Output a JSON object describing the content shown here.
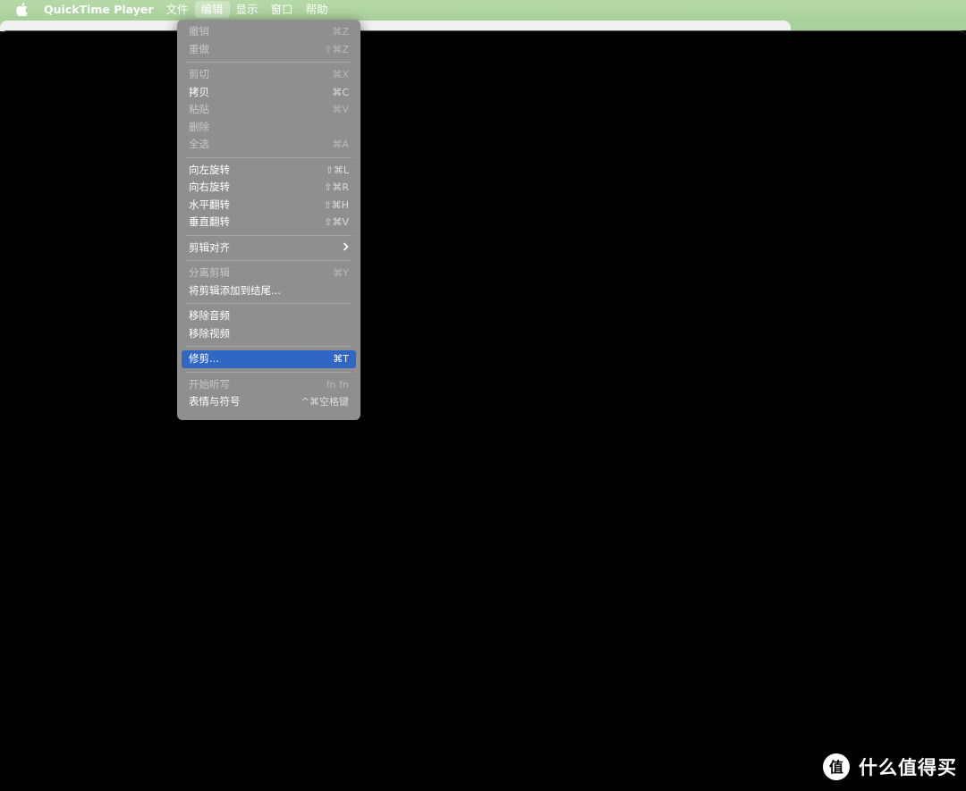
{
  "menubar": {
    "apple_icon": "apple-logo-icon",
    "app_name": "QuickTime Player",
    "items": [
      "文件",
      "编辑",
      "显示",
      "窗口",
      "帮助"
    ],
    "active_index": 1,
    "bar_color": "#a9d19c"
  },
  "edit_menu": {
    "groups": [
      [
        {
          "label": "撤销",
          "shortcut": "⌘Z",
          "enabled": false
        },
        {
          "label": "重做",
          "shortcut": "⇧⌘Z",
          "enabled": false
        }
      ],
      [
        {
          "label": "剪切",
          "shortcut": "⌘X",
          "enabled": false
        },
        {
          "label": "拷贝",
          "shortcut": "⌘C",
          "enabled": true
        },
        {
          "label": "粘贴",
          "shortcut": "⌘V",
          "enabled": false
        },
        {
          "label": "删除",
          "shortcut": "",
          "enabled": false
        },
        {
          "label": "全选",
          "shortcut": "⌘A",
          "enabled": false
        }
      ],
      [
        {
          "label": "向左旋转",
          "shortcut": "⇧⌘L",
          "enabled": true
        },
        {
          "label": "向右旋转",
          "shortcut": "⇧⌘R",
          "enabled": true
        },
        {
          "label": "水平翻转",
          "shortcut": "⇧⌘H",
          "enabled": true
        },
        {
          "label": "垂直翻转",
          "shortcut": "⇧⌘V",
          "enabled": true
        }
      ],
      [
        {
          "label": "剪辑对齐",
          "shortcut": "",
          "enabled": true,
          "submenu": true
        }
      ],
      [
        {
          "label": "分离剪辑",
          "shortcut": "⌘Y",
          "enabled": false
        },
        {
          "label": "将剪辑添加到结尾...",
          "shortcut": "",
          "enabled": true
        }
      ],
      [
        {
          "label": "移除音频",
          "shortcut": "",
          "enabled": true
        },
        {
          "label": "移除视频",
          "shortcut": "",
          "enabled": true
        }
      ],
      [
        {
          "label": "修剪...",
          "shortcut": "⌘T",
          "enabled": true,
          "highlighted": true
        }
      ],
      [
        {
          "label": "开始听写",
          "shortcut": "fn fn",
          "enabled": false
        },
        {
          "label": "表情与符号",
          "shortcut": "^⌘空格键",
          "enabled": true
        }
      ]
    ],
    "highlight_color": "#2f67c2",
    "submenu_icon": "chevron-right-icon"
  },
  "watermark": {
    "logo_icon": "zhi-logo-icon",
    "text": "什么值得买"
  }
}
